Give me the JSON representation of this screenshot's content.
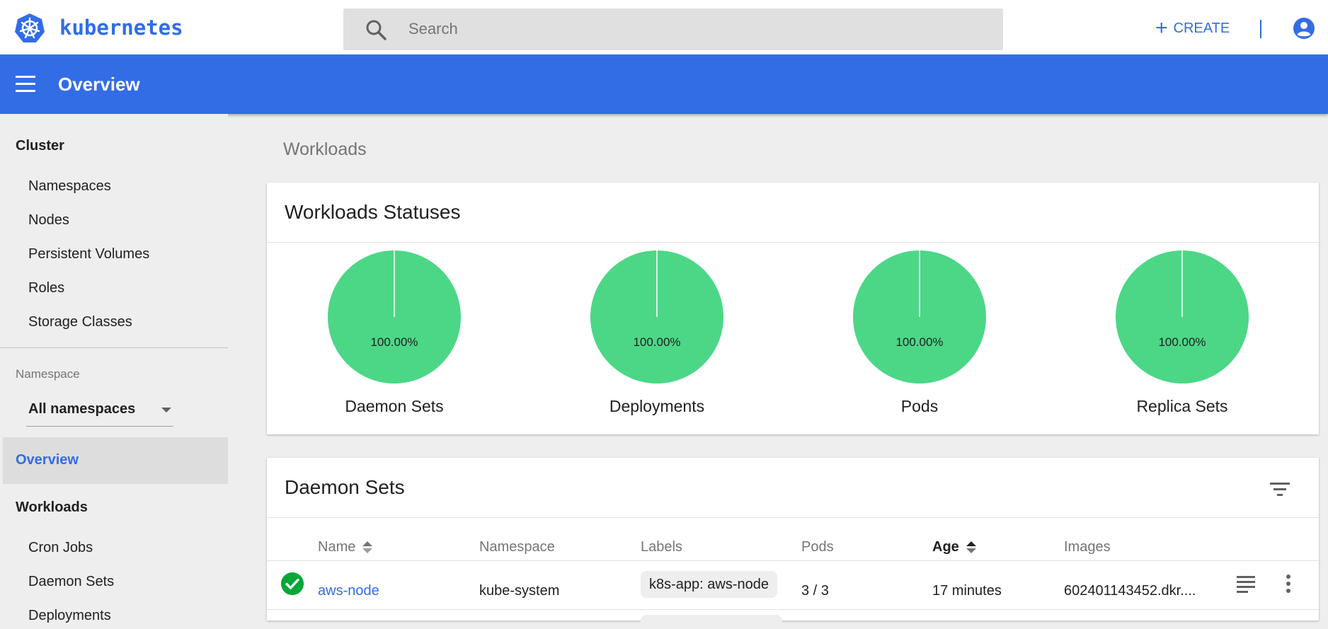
{
  "header": {
    "brand": "kubernetes",
    "search_placeholder": "Search",
    "create_label": "CREATE",
    "create_plus": "+"
  },
  "titlebar": {
    "title": "Overview"
  },
  "sidebar": {
    "cluster_heading": "Cluster",
    "cluster_items": [
      "Namespaces",
      "Nodes",
      "Persistent Volumes",
      "Roles",
      "Storage Classes"
    ],
    "namespace_label": "Namespace",
    "namespace_value": "All namespaces",
    "active_item": "Overview",
    "workloads_heading": "Workloads",
    "workload_items": [
      "Cron Jobs",
      "Daemon Sets",
      "Deployments"
    ]
  },
  "breadcrumb": "Workloads",
  "statuses_card": {
    "title": "Workloads Statuses",
    "pies": [
      {
        "label": "Daemon Sets",
        "percent_text": "100.00%",
        "value": 100
      },
      {
        "label": "Deployments",
        "percent_text": "100.00%",
        "value": 100
      },
      {
        "label": "Pods",
        "percent_text": "100.00%",
        "value": 100
      },
      {
        "label": "Replica Sets",
        "percent_text": "100.00%",
        "value": 100
      }
    ],
    "pie_color": "#4cd787"
  },
  "daemon_sets_card": {
    "title": "Daemon Sets",
    "columns": {
      "name": "Name",
      "namespace": "Namespace",
      "labels": "Labels",
      "pods": "Pods",
      "age": "Age",
      "images": "Images"
    },
    "rows": [
      {
        "name": "aws-node",
        "namespace": "kube-system",
        "label": "k8s-app: aws-node",
        "pods": "3 / 3",
        "age": "17 minutes",
        "images": "602401143452.dkr...."
      }
    ]
  },
  "colors": {
    "accent": "#326de6",
    "ok": "#00a838"
  }
}
